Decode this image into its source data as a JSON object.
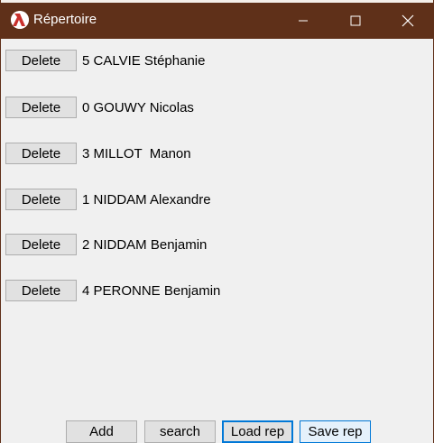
{
  "window": {
    "title": "Répertoire",
    "accent": "#5f3019",
    "icon": "racket-lambda-icon"
  },
  "entries": [
    {
      "button": "Delete",
      "text": "5 CALVIE Stéphanie"
    },
    {
      "button": "Delete",
      "text": "0 GOUWY Nicolas"
    },
    {
      "button": "Delete",
      "text": "3 MILLOT  Manon"
    },
    {
      "button": "Delete",
      "text": "1 NIDDAM Alexandre"
    },
    {
      "button": "Delete",
      "text": "2 NIDDAM Benjamin"
    },
    {
      "button": "Delete",
      "text": "4 PERONNE Benjamin"
    }
  ],
  "actions": {
    "add": "Add",
    "search": "search",
    "load": "Load rep",
    "save": "Save rep"
  }
}
